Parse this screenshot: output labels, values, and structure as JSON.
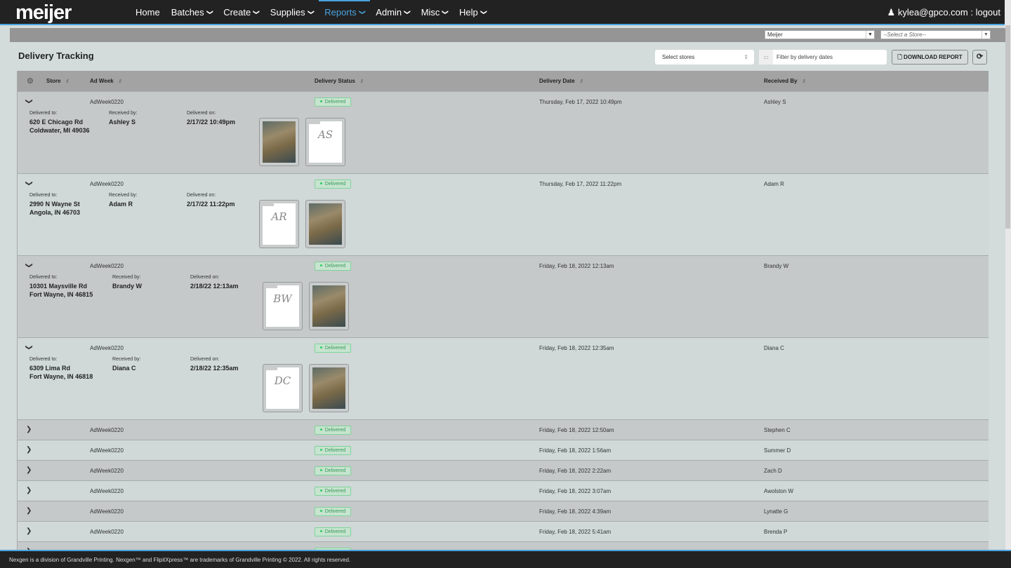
{
  "nav": {
    "logo": "meijer",
    "items": [
      {
        "label": "Home",
        "caret": false
      },
      {
        "label": "Batches",
        "caret": true
      },
      {
        "label": "Create",
        "caret": true
      },
      {
        "label": "Supplies",
        "caret": true
      },
      {
        "label": "Reports",
        "caret": true,
        "active": true
      },
      {
        "label": "Admin",
        "caret": true
      },
      {
        "label": "Misc",
        "caret": true
      },
      {
        "label": "Help",
        "caret": true
      }
    ],
    "user": "kylea@gpco.com : logout",
    "user_icon": "person-icon"
  },
  "topbar": {
    "company_select": "Meijer",
    "store_select": "--Select a Store--"
  },
  "page": {
    "title": "Delivery Tracking",
    "select_stores": "Select stores",
    "date_filter_placeholder": "Filter by delivery dates",
    "download": "DOWNLOAD REPORT",
    "refresh_icon": "refresh-icon"
  },
  "table": {
    "columns": {
      "store": "Store",
      "ad_week": "Ad Week",
      "status": "Delivery Status",
      "date": "Delivery Date",
      "received": "Received By"
    },
    "detail_labels": {
      "to": "Delivered to:",
      "by": "Received by:",
      "on": "Delivered on:"
    },
    "rows": [
      {
        "ad_week": "AdWeek0220",
        "status": "Delivered",
        "date": "Thursday, Feb 17, 2022 10:49pm",
        "received_by": "Ashley S",
        "expanded": true,
        "addr1": "620 E Chicago Rd",
        "addr2": "Coldwater, MI 49036",
        "on": "2/17/22 10:49pm",
        "images": [
          "photo",
          "signature"
        ],
        "sig": "AS"
      },
      {
        "ad_week": "AdWeek0220",
        "status": "Delivered",
        "date": "Thursday, Feb 17, 2022 11:22pm",
        "received_by": "Adam R",
        "expanded": true,
        "addr1": "2990 N Wayne St",
        "addr2": "Angola, IN 46703",
        "on": "2/17/22 11:22pm",
        "images": [
          "signature",
          "photo"
        ],
        "sig": "AR"
      },
      {
        "ad_week": "AdWeek0220",
        "status": "Delivered",
        "date": "Friday, Feb 18, 2022 12:13am",
        "received_by": "Brandy W",
        "expanded": true,
        "addr1": "10301 Maysville Rd",
        "addr2": "Fort Wayne, IN 46815",
        "on": "2/18/22 12:13am",
        "images": [
          "signature",
          "photo"
        ],
        "sig": "BW"
      },
      {
        "ad_week": "AdWeek0220",
        "status": "Delivered",
        "date": "Friday, Feb 18, 2022 12:35am",
        "received_by": "Diana C",
        "expanded": true,
        "addr1": "6309 Lima Rd",
        "addr2": "Fort Wayne, IN 46818",
        "on": "2/18/22 12:35am",
        "images": [
          "signature",
          "photo"
        ],
        "sig": "DC"
      },
      {
        "ad_week": "AdWeek0220",
        "status": "Delivered",
        "date": "Friday, Feb 18, 2022 12:50am",
        "received_by": "Stephen C",
        "expanded": false
      },
      {
        "ad_week": "AdWeek0220",
        "status": "Delivered",
        "date": "Friday, Feb 18, 2022 1:56am",
        "received_by": "Summer D",
        "expanded": false
      },
      {
        "ad_week": "AdWeek0220",
        "status": "Delivered",
        "date": "Friday, Feb 18, 2022 2:22am",
        "received_by": "Zach D",
        "expanded": false
      },
      {
        "ad_week": "AdWeek0220",
        "status": "Delivered",
        "date": "Friday, Feb 18, 2022 3:07am",
        "received_by": "Awolston W",
        "expanded": false
      },
      {
        "ad_week": "AdWeek0220",
        "status": "Delivered",
        "date": "Friday, Feb 18, 2022 4:39am",
        "received_by": "Lynatte G",
        "expanded": false
      },
      {
        "ad_week": "AdWeek0220",
        "status": "Delivered",
        "date": "Friday, Feb 18, 2022 5:41am",
        "received_by": "Brenda P",
        "expanded": false
      },
      {
        "ad_week": "",
        "status": "Delivered",
        "date": "",
        "received_by": "",
        "expanded": false
      }
    ]
  },
  "colors": {
    "nav": "#222222",
    "accent": "#4aa3df",
    "delivered": "#3a9a5a"
  },
  "footer": "Nexgen is a division of Grandville Printing. Nexgen™ and FlipitXpress™ are trademarks of Grandville Printing © 2022. All rights reserved."
}
